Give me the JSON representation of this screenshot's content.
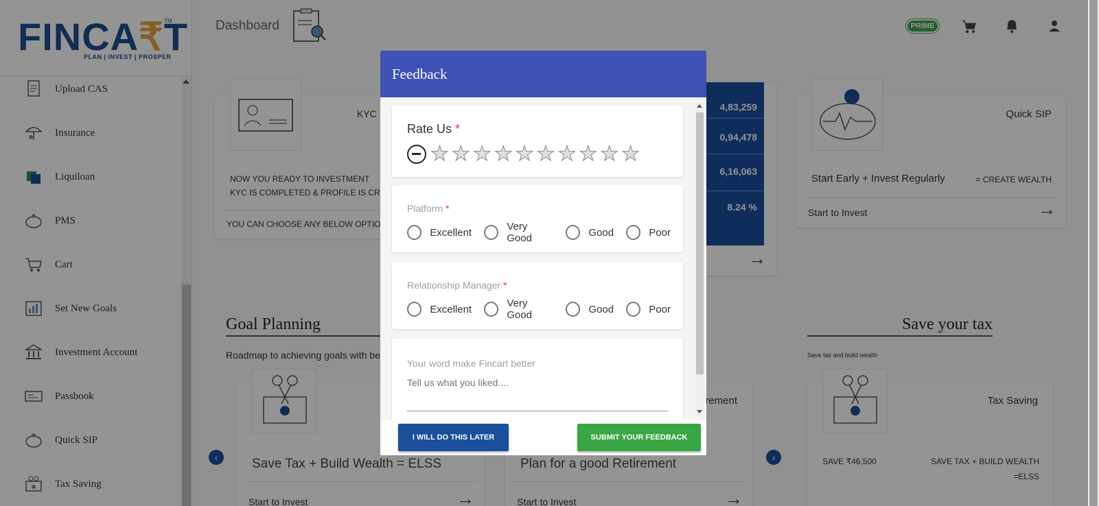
{
  "sidebar": {
    "items": [
      {
        "label": "Upload CAS",
        "icon": "upload-cas-icon"
      },
      {
        "label": "Insurance",
        "icon": "insurance-icon"
      },
      {
        "label": "Liquiloan",
        "icon": "liquiloan-icon"
      },
      {
        "label": "PMS",
        "icon": "pms-icon"
      },
      {
        "label": "Cart",
        "icon": "cart-icon"
      },
      {
        "label": "Set New Goals",
        "icon": "goals-icon"
      },
      {
        "label": "Investment Account",
        "icon": "bank-icon"
      },
      {
        "label": "Passbook",
        "icon": "passbook-icon"
      },
      {
        "label": "Quick SIP",
        "icon": "piggy-bank-icon"
      },
      {
        "label": "Tax Saving",
        "icon": "tax-icon"
      }
    ]
  },
  "logo": {
    "main": "FINCA",
    "rupee": "₹",
    "end": "T",
    "tm": "TM",
    "tagline": "PLAN | INVEST | PROSPER"
  },
  "header": {
    "title": "Dashboard",
    "prime_label": "PRIME"
  },
  "kyc_card": {
    "title": "KYC",
    "line1": "NOW YOU READY TO INVESTMENT",
    "line2": "KYC IS COMPLETED & PROFILE IS CREAT",
    "line3": "YOU CAN CHOOSE ANY BELOW OPTION T"
  },
  "portfolio_values": [
    "4,83,259",
    "0,94,478",
    "6,16,063",
    "8.24 %"
  ],
  "quick_sip_card": {
    "title": "Quick SIP",
    "tagline": "Start Early + Invest Regularly",
    "wealth": "= CREATE WEALTH",
    "cta": "Start to Invest"
  },
  "goal_planning": {
    "title": "Goal Planning",
    "subtitle": "Roadmap to achieving goals with bes",
    "elss_card": {
      "heading": "Save Tax + Build Wealth = ELSS",
      "cta": "Start to Invest"
    },
    "retire_card": {
      "label": "rement",
      "heading": "Plan for a good Retirement",
      "cta": "Start to Invest"
    }
  },
  "save_tax": {
    "title": "Save your tax",
    "subtitle": "Save tax and build wealth",
    "card_title": "Tax Saving",
    "save_amount": "SAVE ₹46,500",
    "elss_line1": "SAVE TAX + BUILD WEALTH",
    "elss_line2": "=ELSS"
  },
  "modal": {
    "title": "Feedback",
    "rate_us_label": "Rate Us",
    "required_mark": "*",
    "stars_total": 10,
    "rating": 0,
    "platform_label": "Platform",
    "rm_label": "Relationship Manager",
    "options": [
      "Excellent",
      "Very Good",
      "Good",
      "Poor"
    ],
    "comment_label": "Your word make Fincart better",
    "comment_placeholder": "Tell us what you liked....",
    "later_button": "I WILL DO THIS LATER",
    "submit_button": "SUBMIT YOUR FEEDBACK"
  },
  "colors": {
    "modal_header": "#3f51b5",
    "later_button": "#1b4e9b",
    "submit_button": "#3aa545",
    "prime_badge": "#3aa545",
    "brand_blue": "#1d4e8f",
    "required": "#e53935"
  }
}
